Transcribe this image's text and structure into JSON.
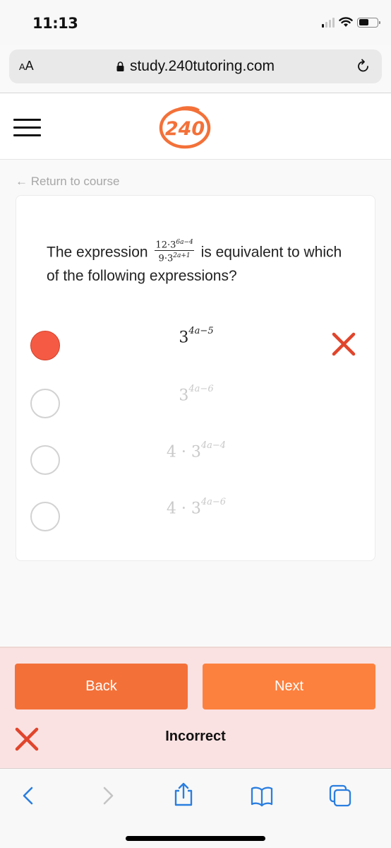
{
  "status_bar": {
    "time": "11:13",
    "signal_bars_active": 1,
    "signal_bars_total": 4,
    "battery_level": 0.55
  },
  "browser": {
    "text_size_label_small": "A",
    "text_size_label_large": "A",
    "url": "study.240tutoring.com",
    "lock_icon": "lock-icon",
    "reload_icon": "reload-icon"
  },
  "site_header": {
    "menu_icon": "hamburger-icon",
    "logo_text": "240"
  },
  "nav": {
    "return_link": "← Return to course"
  },
  "question": {
    "prefix": "The expression",
    "numerator_coef": "12·3",
    "numerator_exp": "6a−4",
    "denominator_coef": "9·3",
    "denominator_exp": "2a+1",
    "suffix": "is equivalent to which of the following expressions?"
  },
  "options": [
    {
      "prefix": "",
      "base": "3",
      "exponent": "4a−5",
      "selected": true,
      "status": "incorrect"
    },
    {
      "prefix": "",
      "base": "3",
      "exponent": "4a−6",
      "selected": false,
      "status": ""
    },
    {
      "prefix": "4 · ",
      "base": "3",
      "exponent": "4a−4",
      "selected": false,
      "status": ""
    },
    {
      "prefix": "4 · ",
      "base": "3",
      "exponent": "4a−6",
      "selected": false,
      "status": ""
    }
  ],
  "feedback": {
    "back_label": "Back",
    "next_label": "Next",
    "result_text": "Incorrect"
  },
  "colors": {
    "brand_orange": "#f37139",
    "next_orange": "#fd813e",
    "incorrect_red": "#e0452c",
    "selected_radio": "#f55b44",
    "feedback_bg": "#fbe2e2",
    "ios_blue": "#2a7ee0"
  },
  "toolbar": {
    "back_icon": "chevron-left-icon",
    "forward_icon": "chevron-right-icon",
    "share_icon": "share-icon",
    "bookmarks_icon": "book-icon",
    "tabs_icon": "tabs-icon"
  }
}
